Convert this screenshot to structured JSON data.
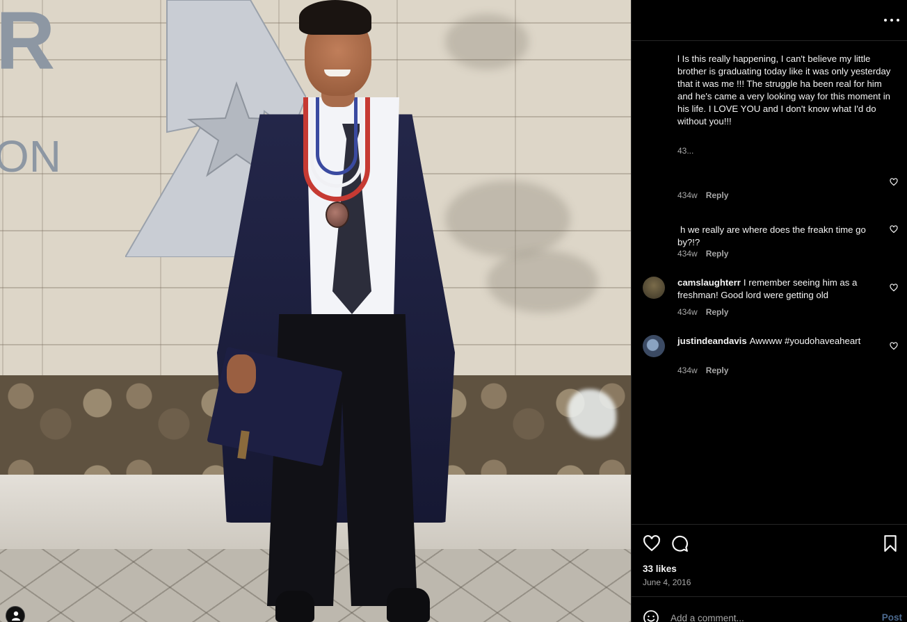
{
  "post": {
    "caption": "l Is this really happening, I can't believe my little brother is graduating today like it was only yesterday that it was me !!! The struggle ha been real for him and he's came a very looking way for this moment in his life. I LOVE YOU and I don't know what I'd do without you!!!",
    "caption_time": "43...",
    "likes_text": "33 likes",
    "date": "June 4, 2016"
  },
  "comments": [
    {
      "user": "",
      "text": "",
      "time": "434w",
      "reply_label": "Reply",
      "avatar_icon": "hidden-avatar"
    },
    {
      "user": "",
      "text": "h we really are where does the freakn time go by?!?",
      "time": "434w",
      "reply_label": "Reply",
      "avatar_icon": "hidden-avatar"
    },
    {
      "user": "camslaughterr",
      "text": "I remember seeing him as a freshman! Good lord were getting old",
      "time": "434w",
      "reply_label": "Reply",
      "avatar_icon": "user-avatar"
    },
    {
      "user": "justindeandavis",
      "text": "Awwww #youdohaveaheart",
      "time": "434w",
      "reply_label": "Reply",
      "avatar_icon": "user-avatar"
    }
  ],
  "composer": {
    "placeholder": "Add a comment...",
    "post_label": "Post"
  },
  "icons": {
    "more": "more-options-icon",
    "like": "heart-icon",
    "comment": "comment-bubble-icon",
    "save": "bookmark-icon",
    "emoji": "emoji-icon",
    "profile": "profile-icon"
  },
  "colors": {
    "background": "#000000",
    "text": "#f5f5f5",
    "muted": "#a8a8a8",
    "post_button": "#4c6a8f",
    "divider": "#262626"
  }
}
